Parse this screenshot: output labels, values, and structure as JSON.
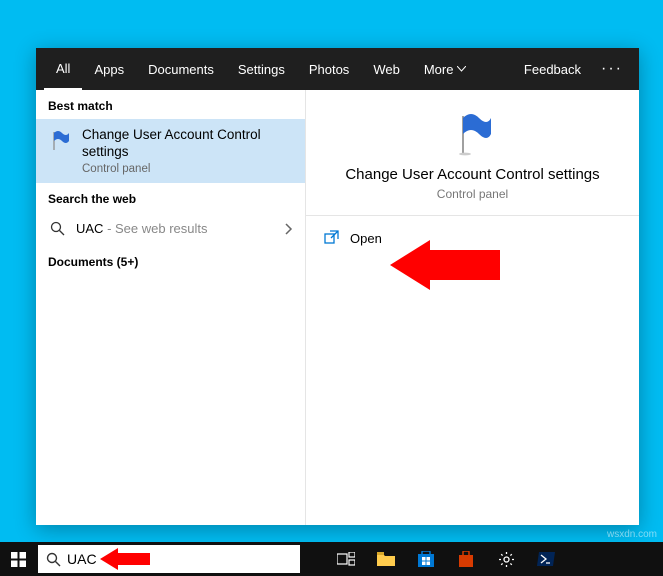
{
  "tabs": {
    "all": "All",
    "apps": "Apps",
    "documents": "Documents",
    "settings": "Settings",
    "photos": "Photos",
    "web": "Web",
    "more": "More",
    "feedback": "Feedback"
  },
  "left": {
    "best_match_label": "Best match",
    "best_match_title": "Change User Account Control settings",
    "best_match_sub": "Control panel",
    "search_web_label": "Search the web",
    "web_query": "UAC",
    "web_suffix": " - See web results",
    "documents_label": "Documents (5+)"
  },
  "preview": {
    "title": "Change User Account Control settings",
    "sub": "Control panel",
    "open": "Open"
  },
  "search": {
    "value": "UAC"
  },
  "watermark": "wsxdn.com"
}
